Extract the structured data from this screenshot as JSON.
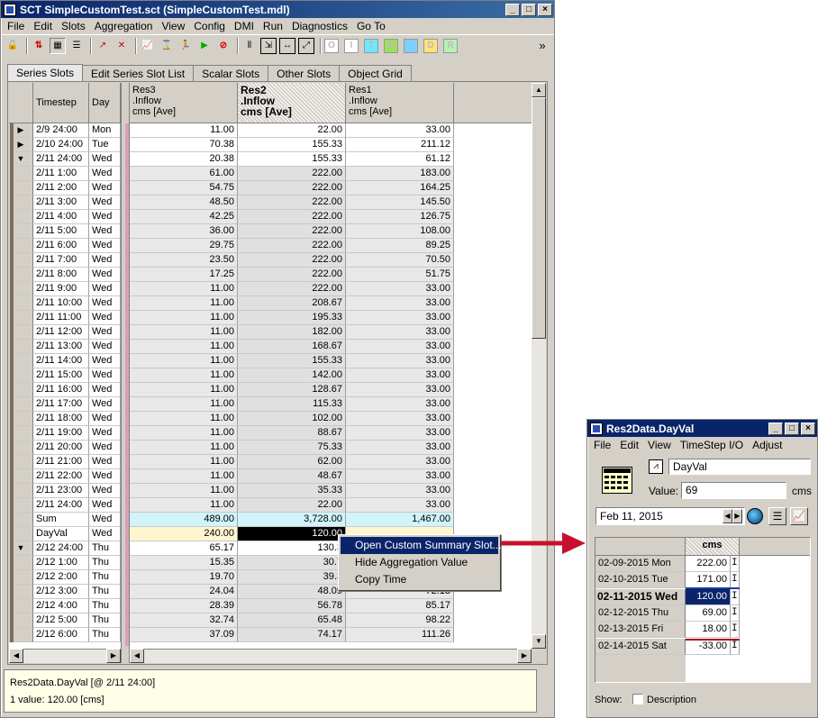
{
  "main_window": {
    "title": "SCT SimpleCustomTest.sct (SimpleCustomTest.mdl)",
    "menu": [
      "File",
      "Edit",
      "Slots",
      "Aggregation",
      "View",
      "Config",
      "DMI",
      "Run",
      "Diagnostics",
      "Go To"
    ],
    "toolbar_overflow": "»",
    "tabs": [
      "Series Slots",
      "Edit Series Slot List",
      "Scalar Slots",
      "Other Slots",
      "Object Grid"
    ],
    "toolbar_letters": [
      "O",
      "I",
      "T",
      "B",
      "",
      "D",
      "R"
    ],
    "toolbar_letter_colors": [
      "#ffffff",
      "#ffffff",
      "#6ee8ff",
      "#9de05a",
      "#7fd0ff",
      "#ffe27a",
      "#b8f0b8"
    ]
  },
  "grid": {
    "col_timestep": "Timestep",
    "col_day": "Day",
    "columns": [
      {
        "name": "Res3",
        "sub": ".Inflow",
        "unit": "cms [Ave]",
        "bold": false
      },
      {
        "name": "Res2",
        "sub": ".Inflow",
        "unit": "cms [Ave]",
        "bold": true
      },
      {
        "name": "Res1",
        "sub": ".Inflow",
        "unit": "cms [Ave]",
        "bold": false
      }
    ],
    "rows": [
      {
        "m": "▶",
        "ts": "2/9 24:00",
        "day": "Mon",
        "v": [
          "11.00",
          "22.00",
          "33.00"
        ],
        "t": "s"
      },
      {
        "m": "▶",
        "ts": "2/10 24:00",
        "day": "Tue",
        "v": [
          "70.38",
          "155.33",
          "211.12"
        ],
        "t": "s"
      },
      {
        "m": "▼",
        "ts": "2/11 24:00",
        "day": "Wed",
        "v": [
          "20.38",
          "155.33",
          "61.12"
        ],
        "t": "s"
      },
      {
        "m": "",
        "ts": "2/11 1:00",
        "day": "Wed",
        "v": [
          "61.00",
          "222.00",
          "183.00"
        ],
        "t": "h"
      },
      {
        "m": "",
        "ts": "2/11 2:00",
        "day": "Wed",
        "v": [
          "54.75",
          "222.00",
          "164.25"
        ],
        "t": "h"
      },
      {
        "m": "",
        "ts": "2/11 3:00",
        "day": "Wed",
        "v": [
          "48.50",
          "222.00",
          "145.50"
        ],
        "t": "h"
      },
      {
        "m": "",
        "ts": "2/11 4:00",
        "day": "Wed",
        "v": [
          "42.25",
          "222.00",
          "126.75"
        ],
        "t": "h"
      },
      {
        "m": "",
        "ts": "2/11 5:00",
        "day": "Wed",
        "v": [
          "36.00",
          "222.00",
          "108.00"
        ],
        "t": "h"
      },
      {
        "m": "",
        "ts": "2/11 6:00",
        "day": "Wed",
        "v": [
          "29.75",
          "222.00",
          "89.25"
        ],
        "t": "h"
      },
      {
        "m": "",
        "ts": "2/11 7:00",
        "day": "Wed",
        "v": [
          "23.50",
          "222.00",
          "70.50"
        ],
        "t": "h"
      },
      {
        "m": "",
        "ts": "2/11 8:00",
        "day": "Wed",
        "v": [
          "17.25",
          "222.00",
          "51.75"
        ],
        "t": "h"
      },
      {
        "m": "",
        "ts": "2/11 9:00",
        "day": "Wed",
        "v": [
          "11.00",
          "222.00",
          "33.00"
        ],
        "t": "h"
      },
      {
        "m": "",
        "ts": "2/11 10:00",
        "day": "Wed",
        "v": [
          "11.00",
          "208.67",
          "33.00"
        ],
        "t": "h"
      },
      {
        "m": "",
        "ts": "2/11 11:00",
        "day": "Wed",
        "v": [
          "11.00",
          "195.33",
          "33.00"
        ],
        "t": "h"
      },
      {
        "m": "",
        "ts": "2/11 12:00",
        "day": "Wed",
        "v": [
          "11.00",
          "182.00",
          "33.00"
        ],
        "t": "h"
      },
      {
        "m": "",
        "ts": "2/11 13:00",
        "day": "Wed",
        "v": [
          "11.00",
          "168.67",
          "33.00"
        ],
        "t": "h"
      },
      {
        "m": "",
        "ts": "2/11 14:00",
        "day": "Wed",
        "v": [
          "11.00",
          "155.33",
          "33.00"
        ],
        "t": "h"
      },
      {
        "m": "",
        "ts": "2/11 15:00",
        "day": "Wed",
        "v": [
          "11.00",
          "142.00",
          "33.00"
        ],
        "t": "h"
      },
      {
        "m": "",
        "ts": "2/11 16:00",
        "day": "Wed",
        "v": [
          "11.00",
          "128.67",
          "33.00"
        ],
        "t": "h"
      },
      {
        "m": "",
        "ts": "2/11 17:00",
        "day": "Wed",
        "v": [
          "11.00",
          "115.33",
          "33.00"
        ],
        "t": "h"
      },
      {
        "m": "",
        "ts": "2/11 18:00",
        "day": "Wed",
        "v": [
          "11.00",
          "102.00",
          "33.00"
        ],
        "t": "h"
      },
      {
        "m": "",
        "ts": "2/11 19:00",
        "day": "Wed",
        "v": [
          "11.00",
          "88.67",
          "33.00"
        ],
        "t": "h"
      },
      {
        "m": "",
        "ts": "2/11 20:00",
        "day": "Wed",
        "v": [
          "11.00",
          "75.33",
          "33.00"
        ],
        "t": "h"
      },
      {
        "m": "",
        "ts": "2/11 21:00",
        "day": "Wed",
        "v": [
          "11.00",
          "62.00",
          "33.00"
        ],
        "t": "h"
      },
      {
        "m": "",
        "ts": "2/11 22:00",
        "day": "Wed",
        "v": [
          "11.00",
          "48.67",
          "33.00"
        ],
        "t": "h"
      },
      {
        "m": "",
        "ts": "2/11 23:00",
        "day": "Wed",
        "v": [
          "11.00",
          "35.33",
          "33.00"
        ],
        "t": "h"
      },
      {
        "m": "",
        "ts": "2/11 24:00",
        "day": "Wed",
        "v": [
          "11.00",
          "22.00",
          "33.00"
        ],
        "t": "h"
      },
      {
        "m": "",
        "ts": "Sum",
        "day": "Wed",
        "v": [
          "489.00",
          "3,728.00",
          "1,467.00"
        ],
        "t": "sum"
      },
      {
        "m": "",
        "ts": "DayVal",
        "day": "Wed",
        "v": [
          "240.00",
          "120.00",
          ""
        ],
        "t": "dv"
      },
      {
        "m": "▼",
        "ts": "2/12 24:00",
        "day": "Thu",
        "v": [
          "65.17",
          "130.3",
          ""
        ],
        "t": "s"
      },
      {
        "m": "",
        "ts": "2/12 1:00",
        "day": "Thu",
        "v": [
          "15.35",
          "30.7",
          ""
        ],
        "t": "h"
      },
      {
        "m": "",
        "ts": "2/12 2:00",
        "day": "Thu",
        "v": [
          "19.70",
          "39.3",
          ""
        ],
        "t": "h"
      },
      {
        "m": "",
        "ts": "2/12 3:00",
        "day": "Thu",
        "v": [
          "24.04",
          "48.09",
          "72.13"
        ],
        "t": "h"
      },
      {
        "m": "",
        "ts": "2/12 4:00",
        "day": "Thu",
        "v": [
          "28.39",
          "56.78",
          "85.17"
        ],
        "t": "h"
      },
      {
        "m": "",
        "ts": "2/12 5:00",
        "day": "Thu",
        "v": [
          "32.74",
          "65.48",
          "98.22"
        ],
        "t": "h"
      },
      {
        "m": "",
        "ts": "2/12 6:00",
        "day": "Thu",
        "v": [
          "37.09",
          "74.17",
          "111.26"
        ],
        "t": "h"
      }
    ]
  },
  "context_menu": [
    "Open Custom Summary Slot...",
    "Hide Aggregation Value",
    "Copy Time"
  ],
  "status": {
    "line1": "Res2Data.DayVal [@ 2/11 24:00]",
    "line2": "1 value: 120.00 [cms]"
  },
  "slot_window": {
    "title": "Res2Data.DayVal",
    "menu": [
      "File",
      "Edit",
      "View",
      "TimeStep I/O",
      "Adjust"
    ],
    "slot_name": "DayVal",
    "value_label": "Value:",
    "value": "69",
    "unit": "cms",
    "date": "Feb 11, 2015",
    "col_header": "cms",
    "rows": [
      {
        "date": "02-09-2015 Mon",
        "val": "222.00",
        "flag": "I",
        "sel": false
      },
      {
        "date": "02-10-2015 Tue",
        "val": "171.00",
        "flag": "I",
        "sel": false
      },
      {
        "date": "02-11-2015 Wed",
        "val": "120.00",
        "flag": "I",
        "sel": true
      },
      {
        "date": "02-12-2015 Thu",
        "val": "69.00",
        "flag": "I",
        "sel": false
      },
      {
        "date": "02-13-2015 Fri",
        "val": "18.00",
        "flag": "I",
        "sel": false
      },
      {
        "date": "02-14-2015 Sat",
        "val": "-33.00",
        "flag": "I",
        "sel": false
      }
    ],
    "show_label": "Show:",
    "description_label": "Description"
  }
}
